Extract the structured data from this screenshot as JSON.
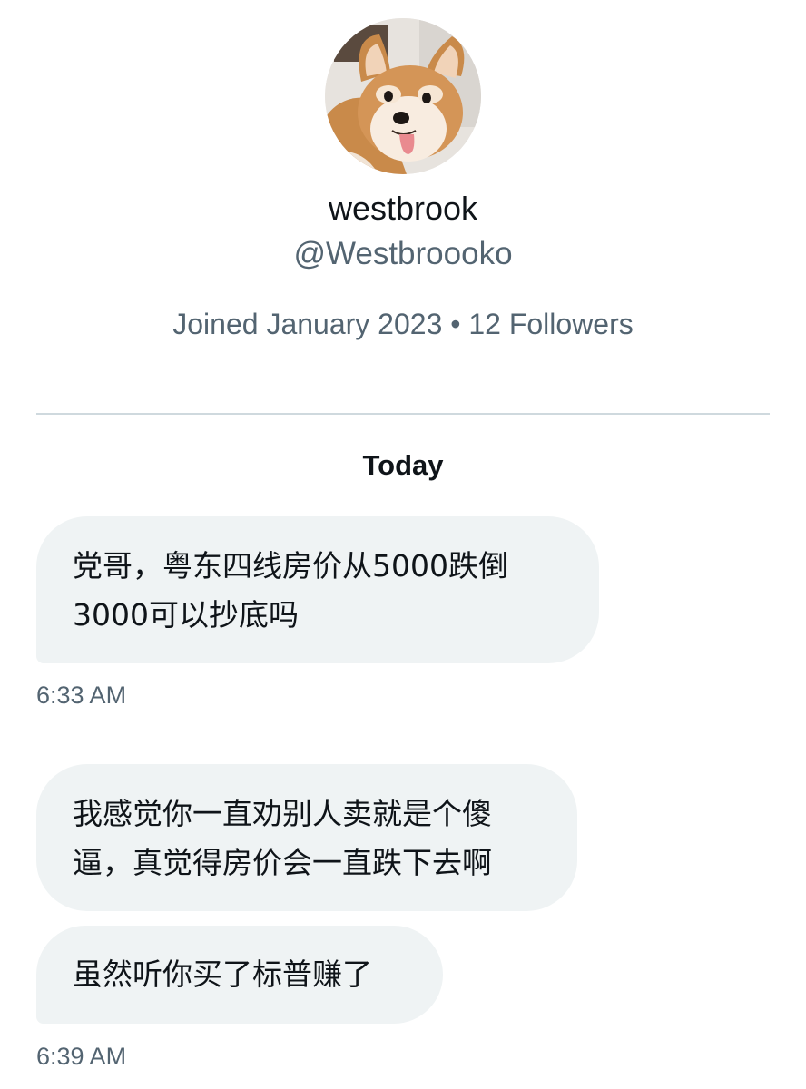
{
  "profile": {
    "display_name": "westbrook",
    "handle": "@Westbroooko",
    "meta": "Joined January 2023 • 12 Followers",
    "avatar_icon": "shiba-inu-dog-avatar"
  },
  "conversation": {
    "day_label": "Today",
    "messages": [
      {
        "lines": [
          "党哥，粤东四线房价从5000跌倒",
          "3000可以抄底吗"
        ],
        "timestamp": "6:33 AM"
      },
      {
        "lines": [
          "我感觉你一直劝别人卖就是个傻",
          "逼，真觉得房价会一直跌下去啊"
        ]
      },
      {
        "lines": [
          "虽然听你买了标普赚了"
        ],
        "timestamp": "6:39 AM"
      }
    ]
  },
  "colors": {
    "bubble_bg": "#eff3f4",
    "secondary_text": "#536471",
    "primary_text": "#0f1419",
    "divider": "#cfd9de"
  }
}
